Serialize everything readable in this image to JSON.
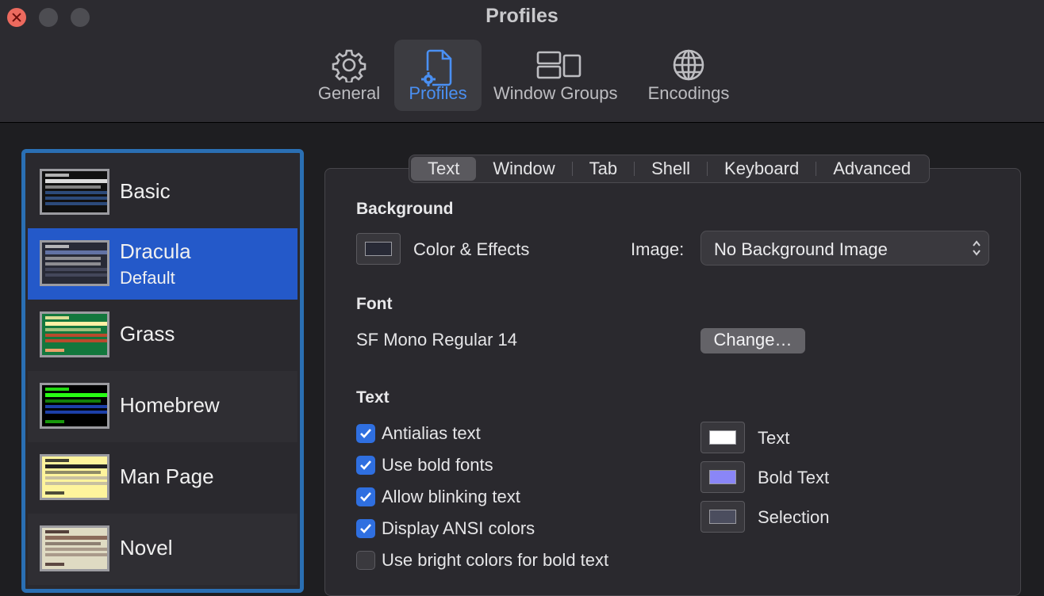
{
  "window": {
    "title": "Profiles"
  },
  "toolbar": {
    "items": [
      {
        "label": "General",
        "icon": "gear-icon"
      },
      {
        "label": "Profiles",
        "icon": "profile-document-icon",
        "active": true
      },
      {
        "label": "Window Groups",
        "icon": "window-groups-icon"
      },
      {
        "label": "Encodings",
        "icon": "globe-icon"
      }
    ]
  },
  "sidebar": {
    "profiles": [
      {
        "name": "Basic",
        "subtitle": "",
        "thumb_bg": "#111111",
        "thumb_accent": "#2c4a7a"
      },
      {
        "name": "Dracula",
        "subtitle": "Default",
        "selected": true,
        "thumb_bg": "#282a36",
        "thumb_accent": "#44475a"
      },
      {
        "name": "Grass",
        "subtitle": "",
        "thumb_bg": "#13773d",
        "thumb_accent": "#b94a2c"
      },
      {
        "name": "Homebrew",
        "subtitle": "",
        "thumb_bg": "#000000",
        "thumb_accent": "#1c3fa8"
      },
      {
        "name": "Man Page",
        "subtitle": "",
        "thumb_bg": "#fef49c",
        "thumb_accent": "#c8c0a0"
      },
      {
        "name": "Novel",
        "subtitle": "",
        "thumb_bg": "#dfdbc3",
        "thumb_accent": "#8a7a6a"
      }
    ]
  },
  "tabs": {
    "items": [
      "Text",
      "Window",
      "Tab",
      "Shell",
      "Keyboard",
      "Advanced"
    ],
    "active": "Text"
  },
  "background": {
    "heading": "Background",
    "color_effects_label": "Color & Effects",
    "image_label": "Image:",
    "image_value": "No Background Image"
  },
  "font": {
    "heading": "Font",
    "value": "SF Mono Regular 14",
    "change_label": "Change…"
  },
  "text": {
    "heading": "Text",
    "checkboxes": [
      {
        "label": "Antialias text",
        "checked": true
      },
      {
        "label": "Use bold fonts",
        "checked": true
      },
      {
        "label": "Allow blinking text",
        "checked": true
      },
      {
        "label": "Display ANSI colors",
        "checked": true
      },
      {
        "label": "Use bright colors for bold text",
        "checked": false
      }
    ],
    "colors": [
      {
        "label": "Text",
        "color": "#ffffff"
      },
      {
        "label": "Bold Text",
        "color": "#8a86f7"
      },
      {
        "label": "Selection",
        "color": "#4b4d5e"
      }
    ]
  },
  "colors": {
    "accent": "#2f6fe0",
    "selection": "#2459c9",
    "sidebar_border": "#2a6fb3"
  }
}
